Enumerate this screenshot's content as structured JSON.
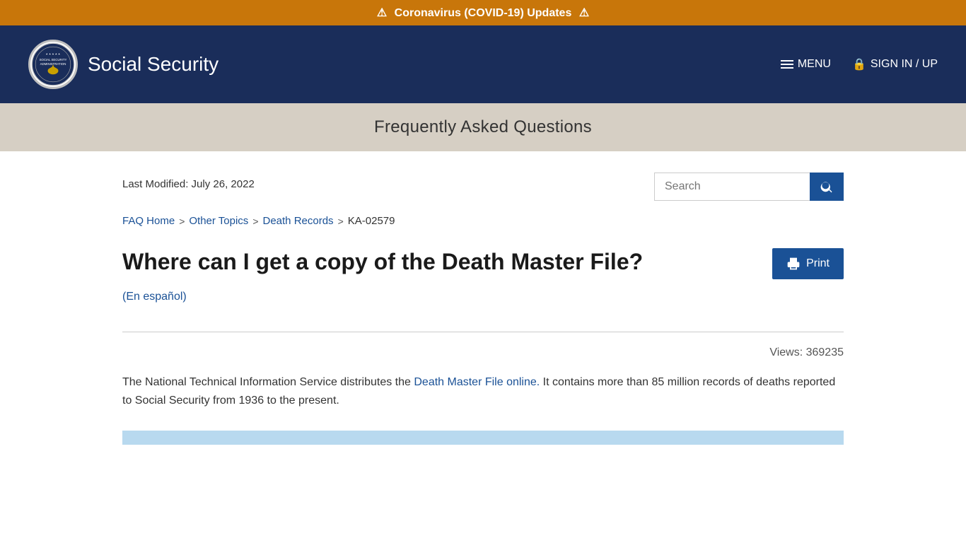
{
  "alert": {
    "text": "Coronavirus (COVID-19) Updates",
    "icon_left": "⚠",
    "icon_right": "⚠"
  },
  "header": {
    "site_title": "Social Security",
    "menu_label": "MENU",
    "signin_label": "SIGN IN / UP",
    "logo_alt": "Social Security Administration seal"
  },
  "page_title_bar": {
    "title": "Frequently Asked Questions"
  },
  "search": {
    "placeholder": "Search",
    "button_label": "Search"
  },
  "meta": {
    "last_modified": "Last Modified: July 26, 2022"
  },
  "breadcrumb": {
    "items": [
      {
        "label": "FAQ Home",
        "href": "#"
      },
      {
        "label": "Other Topics",
        "href": "#"
      },
      {
        "label": "Death Records",
        "href": "#"
      },
      {
        "label": "KA-02579",
        "href": null
      }
    ],
    "separator": ">"
  },
  "article": {
    "title": "Where can I get a copy of the Death Master File?",
    "spanish_link": "(En español)",
    "views_label": "Views:",
    "views_count": "369235",
    "body_part1": "The National Technical Information Service distributes the ",
    "body_link_text": "Death Master File online.",
    "body_part2": " It contains more than 85 million records of deaths reported to Social Security from 1936 to the present.",
    "print_label": "Print"
  }
}
